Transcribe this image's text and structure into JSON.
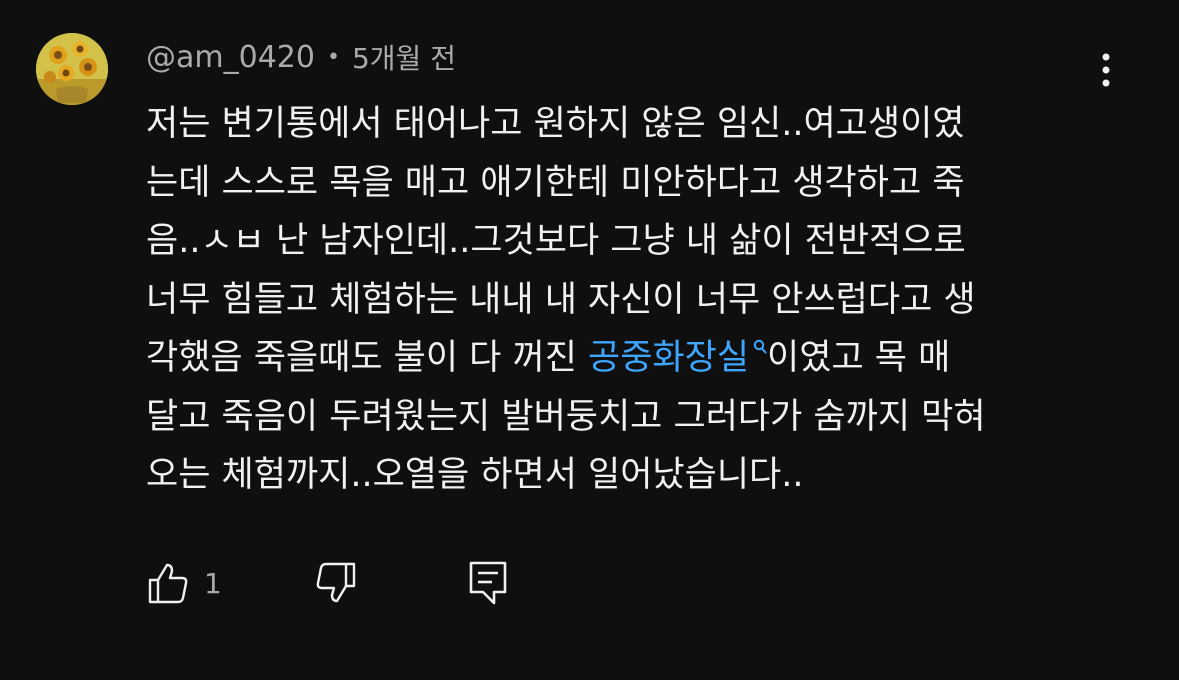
{
  "comment": {
    "author": "@am_0420",
    "separator": "•",
    "time": "5개월 전",
    "text_lines": [
      "저는 변기통에서 태어나고 원하지 않은 임신..여고생이였",
      "는데 스스로 목을 매고 애기한테 미안하다고 생각하고 죽",
      "음..ㅅㅂ 난 남자인데..그것보다 그냥 내 삶이 전반적으로",
      "너무 힘들고 체험하는 내내 내 자신이 너무 안쓰럽다고 생"
    ],
    "line5_before_link": "각했음 죽을때도 불이 다 꺼진 ",
    "link_text": "공중화장실",
    "line5_after_link": "이였고 목 매",
    "text_lines_end": [
      "달고 죽음이 두려웠는지 발버둥치고 그러다가 숨까지 막혀",
      "오는 체험까지..오열을 하면서 일어났습니다.."
    ],
    "like_count": "1"
  },
  "icons": {
    "more": "more-vert-icon",
    "like": "thumb-up-icon",
    "dislike": "thumb-down-icon",
    "reply": "reply-comment-icon",
    "search": "search-icon"
  },
  "colors": {
    "background": "#0f0f0f",
    "text": "#f1f1f1",
    "secondary": "#aaaaaa",
    "link": "#3ea6ff"
  }
}
